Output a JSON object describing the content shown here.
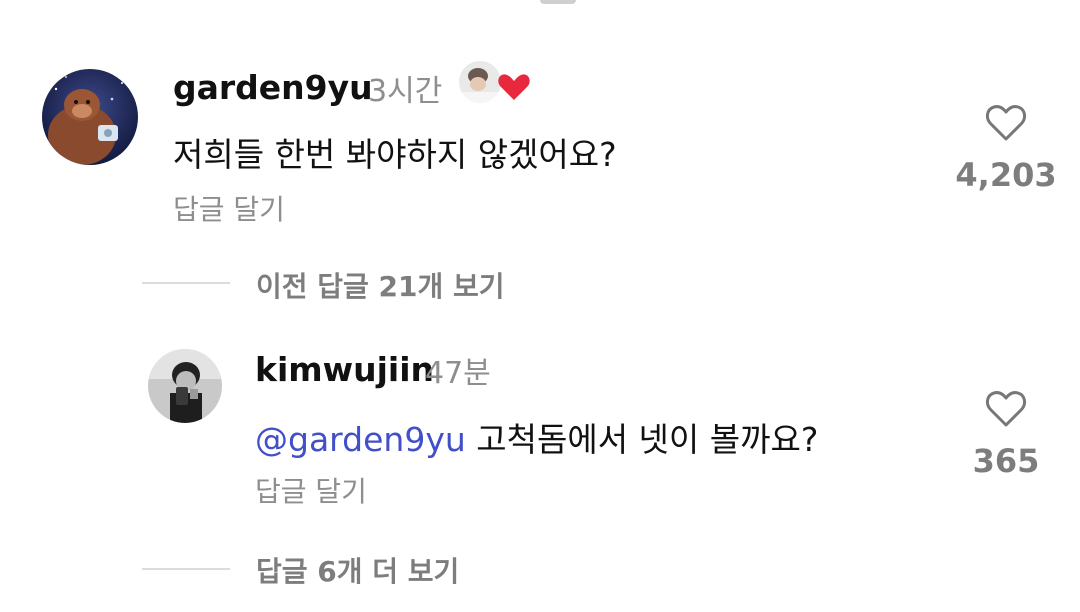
{
  "comments": [
    {
      "username": "garden9yu",
      "time": "3시간",
      "text": "저희들 한번 봐야하지 않겠어요?",
      "reply_label": "답글 달기",
      "like_count": "4,203",
      "avatar_icon": "orangutan-avatar",
      "creator_liked_icon": "creator-heart-badge"
    },
    {
      "username": "kimwujiin",
      "time": "47분",
      "mention": "@garden9yu",
      "text": " 고척돔에서 넷이 볼까요?",
      "reply_label": "답글 달기",
      "like_count": "365",
      "avatar_icon": "mirror-selfie-avatar"
    }
  ],
  "threads": {
    "view_previous": "이전 답글 21개 보기",
    "view_more": "답글 6개 더 보기"
  },
  "colors": {
    "mention": "#4150c9",
    "heart_badge": "#e8283c",
    "secondary_text": "#8e8e8e"
  }
}
